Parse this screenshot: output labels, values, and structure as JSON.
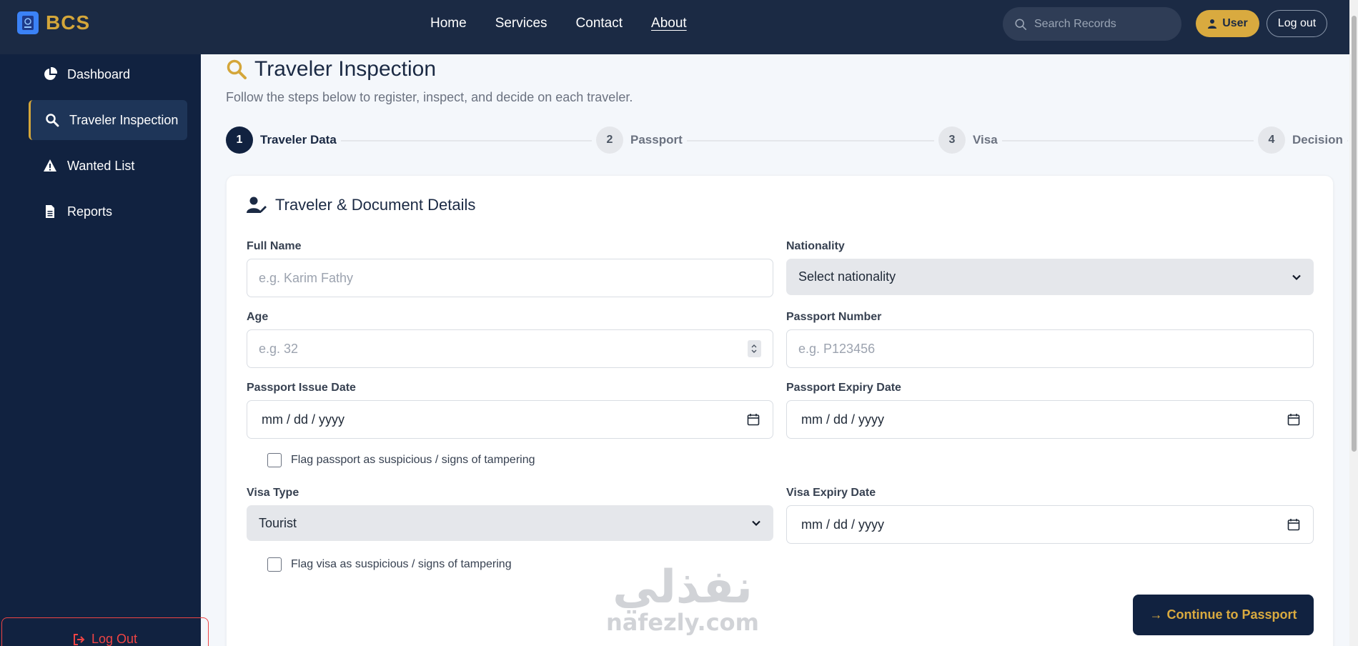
{
  "brand": {
    "name": "BCS",
    "logo_icon": "passport-icon"
  },
  "nav": {
    "items": [
      "Home",
      "Services",
      "Contact",
      "About"
    ]
  },
  "search": {
    "placeholder": "Search Records"
  },
  "header": {
    "user_label": "User",
    "logout_label": "Log out"
  },
  "sidebar": {
    "items": [
      {
        "label": "Dashboard",
        "icon": "pie-chart-icon"
      },
      {
        "label": "Traveler Inspection",
        "icon": "search-icon",
        "active": true
      },
      {
        "label": "Wanted List",
        "icon": "warning-icon"
      },
      {
        "label": "Reports",
        "icon": "document-icon"
      }
    ],
    "logout_label": "Log Out"
  },
  "page": {
    "title": "Traveler Inspection",
    "subtitle": "Follow the steps below to register, inspect, and decide on each traveler."
  },
  "stepper": {
    "steps": [
      {
        "number": "1",
        "label": "Traveler Data",
        "active": true
      },
      {
        "number": "2",
        "label": "Passport"
      },
      {
        "number": "3",
        "label": "Visa"
      },
      {
        "number": "4",
        "label": "Decision"
      }
    ]
  },
  "form": {
    "title": "Traveler & Document Details",
    "full_name": {
      "label": "Full Name",
      "placeholder": "e.g. Karim Fathy"
    },
    "nationality": {
      "label": "Nationality",
      "value": "Select nationality"
    },
    "age": {
      "label": "Age",
      "placeholder": "e.g. 32"
    },
    "passport_number": {
      "label": "Passport Number",
      "placeholder": "e.g. P123456"
    },
    "passport_issue_date": {
      "label": "Passport Issue Date",
      "value": "mm / dd / yyyy"
    },
    "passport_expiry_date": {
      "label": "Passport Expiry Date",
      "value": "mm / dd / yyyy"
    },
    "passport_flag_label": "Flag passport as suspicious / signs of tampering",
    "visa_type": {
      "label": "Visa Type",
      "value": "Tourist"
    },
    "visa_expiry_date": {
      "label": "Visa Expiry Date",
      "value": "mm / dd / yyyy"
    },
    "visa_flag_label": "Flag visa as suspicious / signs of tampering",
    "continue_label": "Continue to Passport"
  },
  "watermark": {
    "arabic": "نفذلي",
    "latin": "nafezly.com"
  },
  "colors": {
    "navy": "#112240",
    "topbar": "#1b2a44",
    "gold": "#d9aa3f",
    "danger": "#ef4444"
  }
}
